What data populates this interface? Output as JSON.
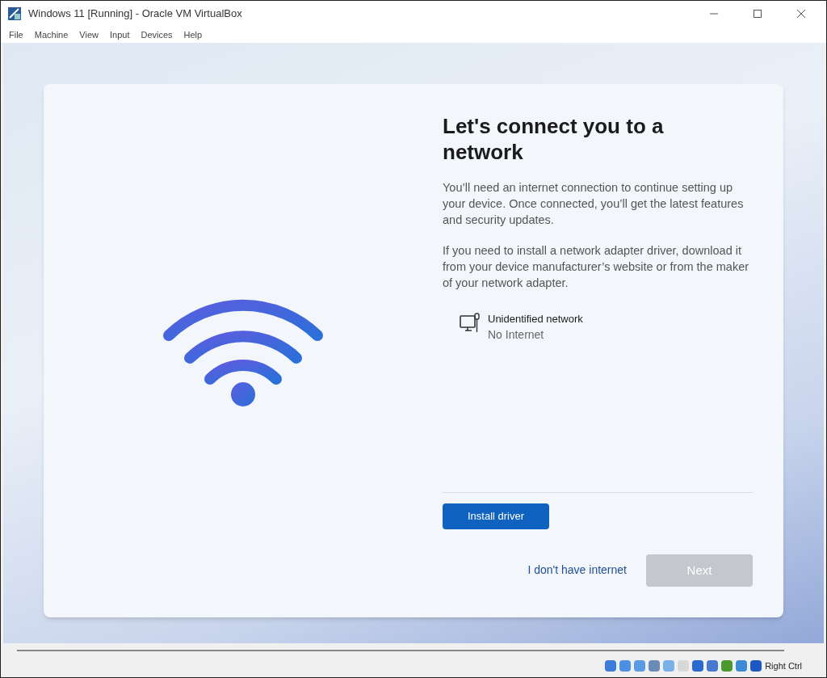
{
  "window": {
    "title": "Windows 11 [Running] - Oracle VM VirtualBox"
  },
  "menu": [
    "File",
    "Machine",
    "View",
    "Input",
    "Devices",
    "Help"
  ],
  "setup": {
    "heading": "Let's connect you to a network",
    "paragraphs": [
      "You’ll need an internet connection to continue setting up your device. Once connected, you’ll get the latest features and security updates.",
      "If you need to install a network adapter driver, download it from your device manufacturer’s website or from the maker of your network adapter."
    ],
    "network": {
      "name": "Unidentified network",
      "status": "No Internet"
    },
    "install_button": "Install driver",
    "skip_link": "I don't have internet",
    "next_button": {
      "label": "Next",
      "disabled": true
    }
  },
  "status_bar": {
    "host_key": "Right Ctrl"
  }
}
